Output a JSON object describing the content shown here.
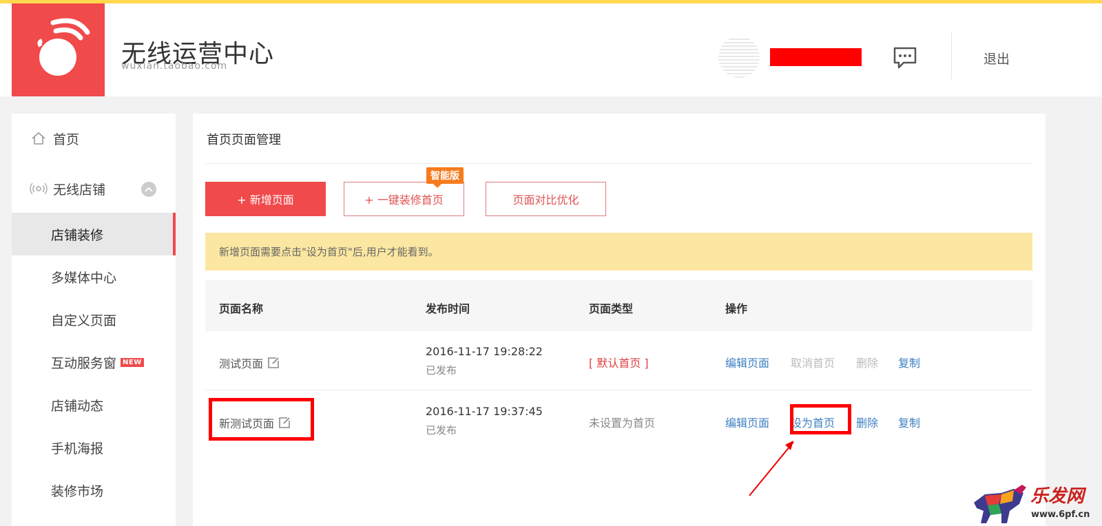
{
  "header": {
    "brand_title": "无线运营中心",
    "brand_sub": "wuxian.taobao.com",
    "logout_label": "退出"
  },
  "sidebar": {
    "items": [
      {
        "label": "首页",
        "icon": "home-icon"
      },
      {
        "label": "无线店铺",
        "icon": "wireless-icon"
      },
      {
        "label": "店铺装修",
        "active": true
      },
      {
        "label": "多媒体中心"
      },
      {
        "label": "自定义页面"
      },
      {
        "label": "互动服务窗",
        "badge": "NEW"
      },
      {
        "label": "店铺动态"
      },
      {
        "label": "手机海报"
      },
      {
        "label": "装修市场"
      }
    ]
  },
  "main": {
    "title": "首页页面管理",
    "buttons": {
      "add_page": "+ 新增页面",
      "one_key": "+ 一键装修首页",
      "compare": "页面对比优化",
      "smart_tag": "智能版"
    },
    "notice": "新增页面需要点击\"设为首页\"后,用户才能看到。",
    "table": {
      "headers": [
        "页面名称",
        "发布时间",
        "页面类型",
        "操作"
      ],
      "rows": [
        {
          "name": "测试页面",
          "time": "2016-11-17 19:28:22",
          "status": "已发布",
          "type": "[ 默认首页 ]",
          "ops": [
            "编辑页面",
            "取消首页",
            "删除",
            "复制"
          ]
        },
        {
          "name": "新测试页面",
          "time": "2016-11-17 19:37:45",
          "status": "已发布",
          "type": "未设置为首页",
          "ops": [
            "编辑页面",
            "设为首页",
            "删除",
            "复制"
          ]
        }
      ]
    }
  },
  "watermark": {
    "text": "乐发网",
    "url": "www.6pf.cn"
  },
  "colors": {
    "brand_red": "#f04a4b",
    "top_bar_yellow": "#ffd84f",
    "notice_bg": "#fbe7a1",
    "link_blue": "#3d7fc1",
    "smart_tag_orange": "#f77b1d"
  }
}
